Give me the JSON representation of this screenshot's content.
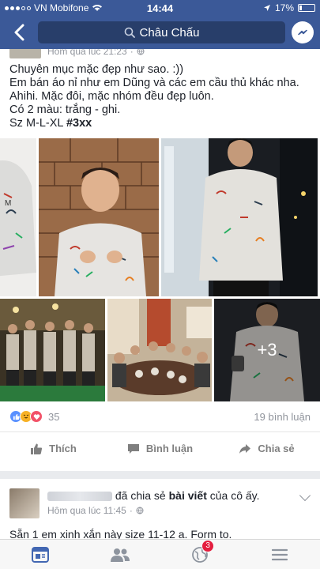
{
  "status_bar": {
    "carrier": "VN Mobifone",
    "time": "14:44",
    "battery": "17%"
  },
  "nav": {
    "search_text": "Châu Chấu"
  },
  "post1": {
    "time": "Hôm qua lúc 21:23",
    "lines": [
      "Chuyên mục mặc đẹp như sao. :))",
      "Em bán áo nỉ như em Dũng và các em cầu thủ khác nha.",
      "Ahihi. Mặc đôi, mặc nhóm đều đẹp luôn.",
      "Có 2 màu: trắng - ghi."
    ],
    "size_text": "Sz M-L-XL",
    "hashtag": "#3xx",
    "more_photos": "+3",
    "reaction_count": "35",
    "comments": "19 bình luận",
    "actions": {
      "like": "Thích",
      "comment": "Bình luận",
      "share": "Chia sẻ"
    }
  },
  "post2": {
    "shared_text": " đã chia sẻ",
    "shared_object": "bài viết",
    "shared_suffix": " của cô ấy.",
    "time": "Hôm qua lúc 11:45",
    "body": "Sẵn 1 em xinh xắn này size 11-12 a. Form to."
  },
  "tabs": {
    "notifications_badge": "3"
  },
  "colors": {
    "brand": "#3b5998",
    "badge": "#e41e3f"
  }
}
